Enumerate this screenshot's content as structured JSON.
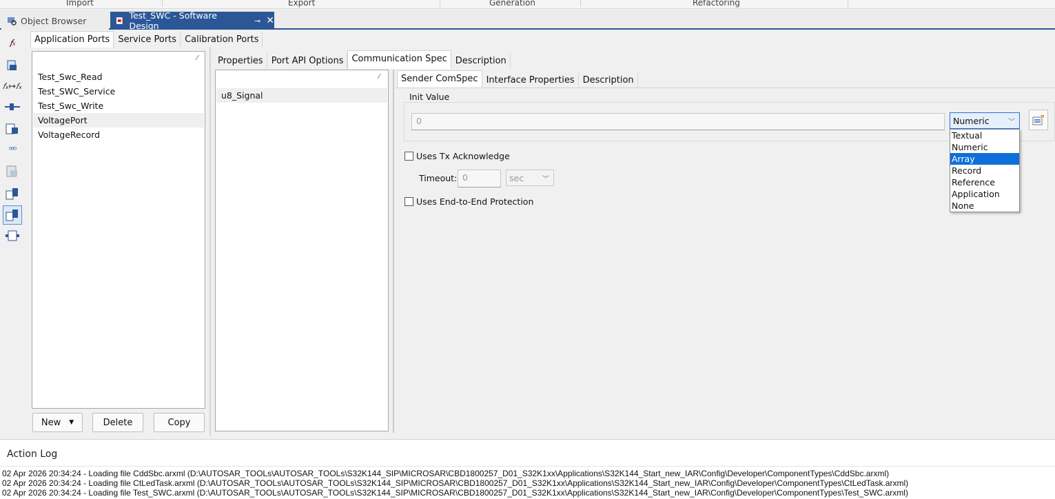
{
  "ribbon": {
    "groups": [
      "Import",
      "Export",
      "Generation",
      "Refactoring"
    ]
  },
  "doc_tabs": {
    "object_browser": "Object Browser",
    "active": "Test_SWC - Software Design"
  },
  "port_tabs": [
    "Application Ports",
    "Service Ports",
    "Calibration Ports"
  ],
  "ports": [
    "Test_Swc_Read",
    "Test_SWC_Service",
    "Test_Swc_Write",
    "VoltagePort",
    "VoltageRecord"
  ],
  "port_buttons": {
    "new": "New",
    "delete": "Delete",
    "copy": "Copy"
  },
  "detail_tabs": [
    "Properties",
    "Port API Options",
    "Communication Spec",
    "Description"
  ],
  "data_elements": [
    "u8_Signal"
  ],
  "comspec_tabs": [
    "Sender ComSpec",
    "Interface Properties",
    "Description"
  ],
  "comspec": {
    "init_value_label": "Init Value",
    "init_value": "0",
    "init_type_selected": "Numeric",
    "init_type_options": [
      "Textual",
      "Numeric",
      "Array",
      "Record",
      "Reference",
      "Application",
      "None"
    ],
    "init_type_highlighted": "Array",
    "tx_ack_label": "Uses Tx Acknowledge",
    "timeout_label": "Timeout:",
    "timeout_value": "0",
    "timeout_unit": "sec",
    "e2e_label": "Uses End-to-End Protection"
  },
  "action_log": {
    "title": "Action Log",
    "lines": [
      "02 Apr 2026 20:34:24 - Loading file CddSbc.arxml (D:\\AUTOSAR_TOOLs\\AUTOSAR_TOOLs\\S32K144_SIP\\MICROSAR\\CBD1800257_D01_S32K1xx\\Applications\\S32K144_Start_new_IAR\\Config\\Developer\\ComponentTypes\\CddSbc.arxml)",
      "02 Apr 2026 20:34:24 - Loading file CtLedTask.arxml (D:\\AUTOSAR_TOOLs\\AUTOSAR_TOOLs\\S32K144_SIP\\MICROSAR\\CBD1800257_D01_S32K1xx\\Applications\\S32K144_Start_new_IAR\\Config\\Developer\\ComponentTypes\\CtLedTask.arxml)",
      "02 Apr 2026 20:34:24 - Loading file Test_SWC.arxml (D:\\AUTOSAR_TOOLs\\AUTOSAR_TOOLs\\S32K144_SIP\\MICROSAR\\CBD1800257_D01_S32K1xx\\Applications\\S32K144_Start_new_IAR\\Config\\Developer\\ComponentTypes\\Test_SWC.arxml)"
    ]
  },
  "colors": {
    "accent": "#2b5797",
    "highlight": "#0f6fd8"
  }
}
